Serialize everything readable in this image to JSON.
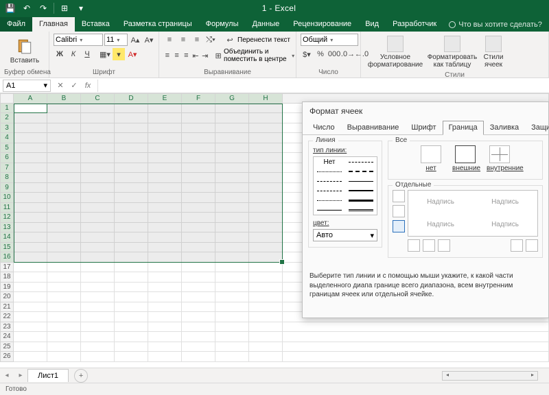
{
  "app": {
    "title": "1 - Excel"
  },
  "tabs": {
    "file": "Файл",
    "items": [
      "Главная",
      "Вставка",
      "Разметка страницы",
      "Формулы",
      "Данные",
      "Рецензирование",
      "Вид",
      "Разработчик"
    ],
    "active": 0,
    "tell_me": "Что вы хотите сделать?"
  },
  "ribbon": {
    "clipboard": {
      "paste": "Вставить",
      "label": "Буфер обмена"
    },
    "font": {
      "name": "Calibri",
      "size": "11",
      "inc": "A",
      "dec": "A",
      "label": "Шрифт"
    },
    "align": {
      "wrap": "Перенести текст",
      "merge": "Объединить и поместить в центре",
      "label": "Выравнивание"
    },
    "number": {
      "format": "Общий",
      "label": "Число"
    },
    "styles": {
      "cond": "Условное\nформатирование",
      "table": "Форматировать\nкак таблицу",
      "cell": "Стили\nячеек",
      "label": "Стили"
    }
  },
  "formula_bar": {
    "name_box": "A1",
    "value": ""
  },
  "sheet": {
    "columns": [
      "A",
      "B",
      "C",
      "D",
      "E",
      "F",
      "G",
      "H"
    ],
    "rows_visible": 26,
    "selection": "A1:H16",
    "active": "A1"
  },
  "tabs_bottom": {
    "sheet1": "Лист1",
    "add": "+"
  },
  "status": {
    "text": "Готово"
  },
  "dialog": {
    "title": "Формат ячеек",
    "tabs": [
      "Число",
      "Выравнивание",
      "Шрифт",
      "Граница",
      "Заливка",
      "Защита"
    ],
    "active_tab": 3,
    "line_group": "Линия",
    "line_type_label": "тип линии:",
    "line_none": "Нет",
    "color_label": "цвет:",
    "color_value": "Авто",
    "all_group": "Все",
    "presets": {
      "none": "нет",
      "outline": "внешние",
      "inside": "внутренние"
    },
    "separate_group": "Отдельные",
    "preview_text": "Надпись",
    "hint": "Выберите тип линии и с помощью мыши укажите, к какой части выделенного диапа границе всего диапазона, всем внутренним границам ячеек или отдельной ячейке."
  }
}
